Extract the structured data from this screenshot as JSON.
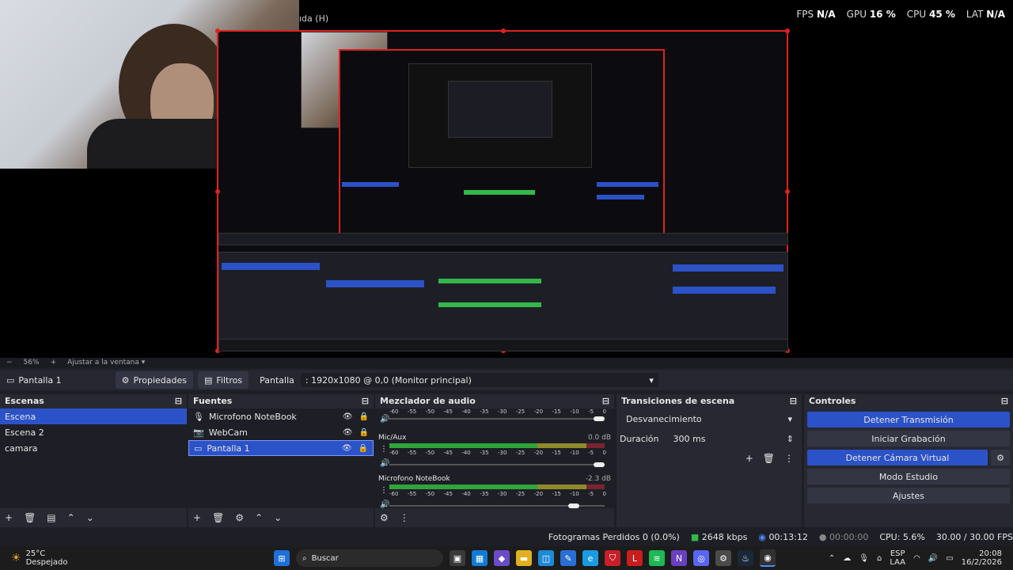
{
  "window": {
    "title_fragment": "ıda (H)"
  },
  "stats": [
    {
      "label": "FPS",
      "value": "N/A"
    },
    {
      "label": "GPU",
      "value": "16 %"
    },
    {
      "label": "CPU",
      "value": "45 %"
    },
    {
      "label": "LAT",
      "value": "N/A"
    }
  ],
  "zoom": {
    "level": "56%",
    "fit_label": "Ajustar a la ventana"
  },
  "source_toolbar": {
    "source_name": "Pantalla 1",
    "properties_label": "Propiedades",
    "filters_label": "Filtros",
    "display_label": "Pantalla",
    "display_value": ": 1920x1080 @ 0,0 (Monitor principal)"
  },
  "scenes": {
    "title": "Escenas",
    "items": [
      "Escena",
      "Escena 2",
      "camara"
    ]
  },
  "sources": {
    "title": "Fuentes",
    "items": [
      "Microfono NoteBook",
      "WebCam",
      "Pantalla 1"
    ]
  },
  "mixer": {
    "title": "Mezclador de audio",
    "scale": [
      "-60",
      "-55",
      "-50",
      "-45",
      "-40",
      "-35",
      "-30",
      "-25",
      "-20",
      "-15",
      "-10",
      "-5",
      "0"
    ],
    "channels": [
      {
        "name": "",
        "db": ""
      },
      {
        "name": "Mic/Aux",
        "db": "0.0 dB"
      },
      {
        "name": "Microfono NoteBook",
        "db": "-2.3 dB"
      }
    ]
  },
  "transitions": {
    "title": "Transiciones de escena",
    "type": "Desvanecimiento",
    "duration_label": "Duración",
    "duration_value": "300 ms"
  },
  "controls": {
    "title": "Controles",
    "buttons": [
      "Detener Transmisión",
      "Iniciar Grabación",
      "Detener Cámara Virtual",
      "Modo Estudio",
      "Ajustes"
    ]
  },
  "status": {
    "dropped": "Fotogramas Perdidos 0 (0.0%)",
    "bitrate": "2648 kbps",
    "stream_time": "00:13:12",
    "rec_time": "00:00:00",
    "cpu": "CPU: 5.6%",
    "fps": "30.00 / 30.00 FPS"
  },
  "taskbar": {
    "weather_temp": "25°C",
    "weather_desc": "Despejado",
    "search": "Buscar",
    "lang": "ESP",
    "lang2": "LAA",
    "time": "20:08",
    "date": "16/2/2026"
  }
}
